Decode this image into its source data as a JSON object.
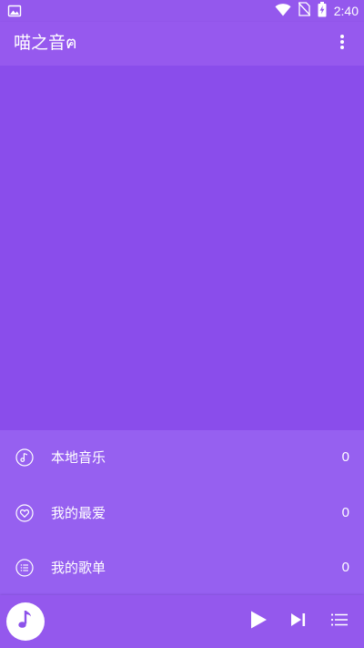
{
  "status_bar": {
    "time": "2:40",
    "icons": [
      "image-notification-icon",
      "wifi-icon",
      "no-sim-icon",
      "battery-charging-icon"
    ]
  },
  "app_bar": {
    "title": "喵之音ฅ",
    "menu_icon": "more-vert-icon"
  },
  "menu": {
    "items": [
      {
        "label": "本地音乐",
        "count": "0",
        "icon": "music-note-circle-icon"
      },
      {
        "label": "我的最爱",
        "count": "0",
        "icon": "heart-circle-icon"
      },
      {
        "label": "我的歌单",
        "count": "0",
        "icon": "list-circle-icon"
      }
    ]
  },
  "player": {
    "album_icon": "music-note-icon",
    "controls": [
      "play-icon",
      "skip-next-icon",
      "queue-list-icon"
    ]
  },
  "colors": {
    "status_bar": "#9458ed",
    "app_bar": "#9659ee",
    "content": "#8a4deb",
    "menu": "#9660f0",
    "accent": "#8c52ea",
    "text": "#ffffff"
  }
}
